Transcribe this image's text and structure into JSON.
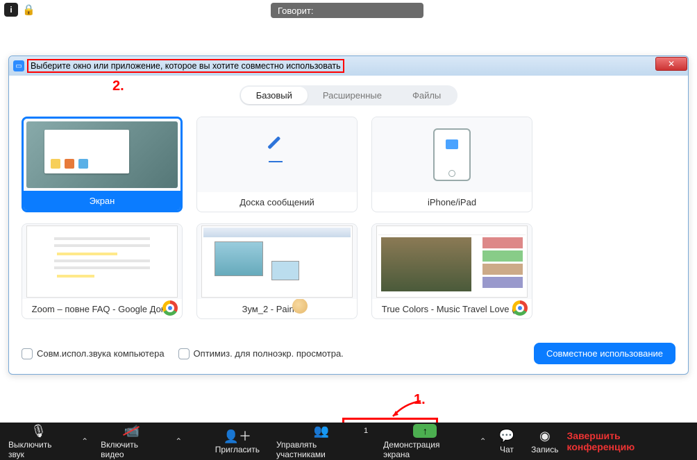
{
  "top": {
    "speaking_label": "Говорит:"
  },
  "dialog": {
    "title": "Выберите окно или приложение, которое вы хотите совместно использовать",
    "tabs": {
      "basic": "Базовый",
      "advanced": "Расширенные",
      "files": "Файлы"
    },
    "cards": {
      "screen": "Экран",
      "whiteboard": "Доска сообщений",
      "iphone": "iPhone/iPad",
      "w1": "Zoom – повне FAQ - Google Док...",
      "w2": "Зум_2 - Paint",
      "w3": "True Colors - Music Travel Love (..."
    },
    "opt_audio": "Совм.испол.звука компьютера",
    "opt_fullscreen": "Оптимиз. для полноэкр. просмотра.",
    "share_btn": "Совместное использование"
  },
  "annot": {
    "n1": "1.",
    "n2": "2."
  },
  "toolbar": {
    "mute": "Выключить звук",
    "video": "Включить видео",
    "invite": "Пригласить",
    "participants": "Управлять участниками",
    "participants_count": "1",
    "share": "Демонстрация экрана",
    "chat": "Чат",
    "record": "Запись",
    "end": "Завершить конференцию"
  }
}
